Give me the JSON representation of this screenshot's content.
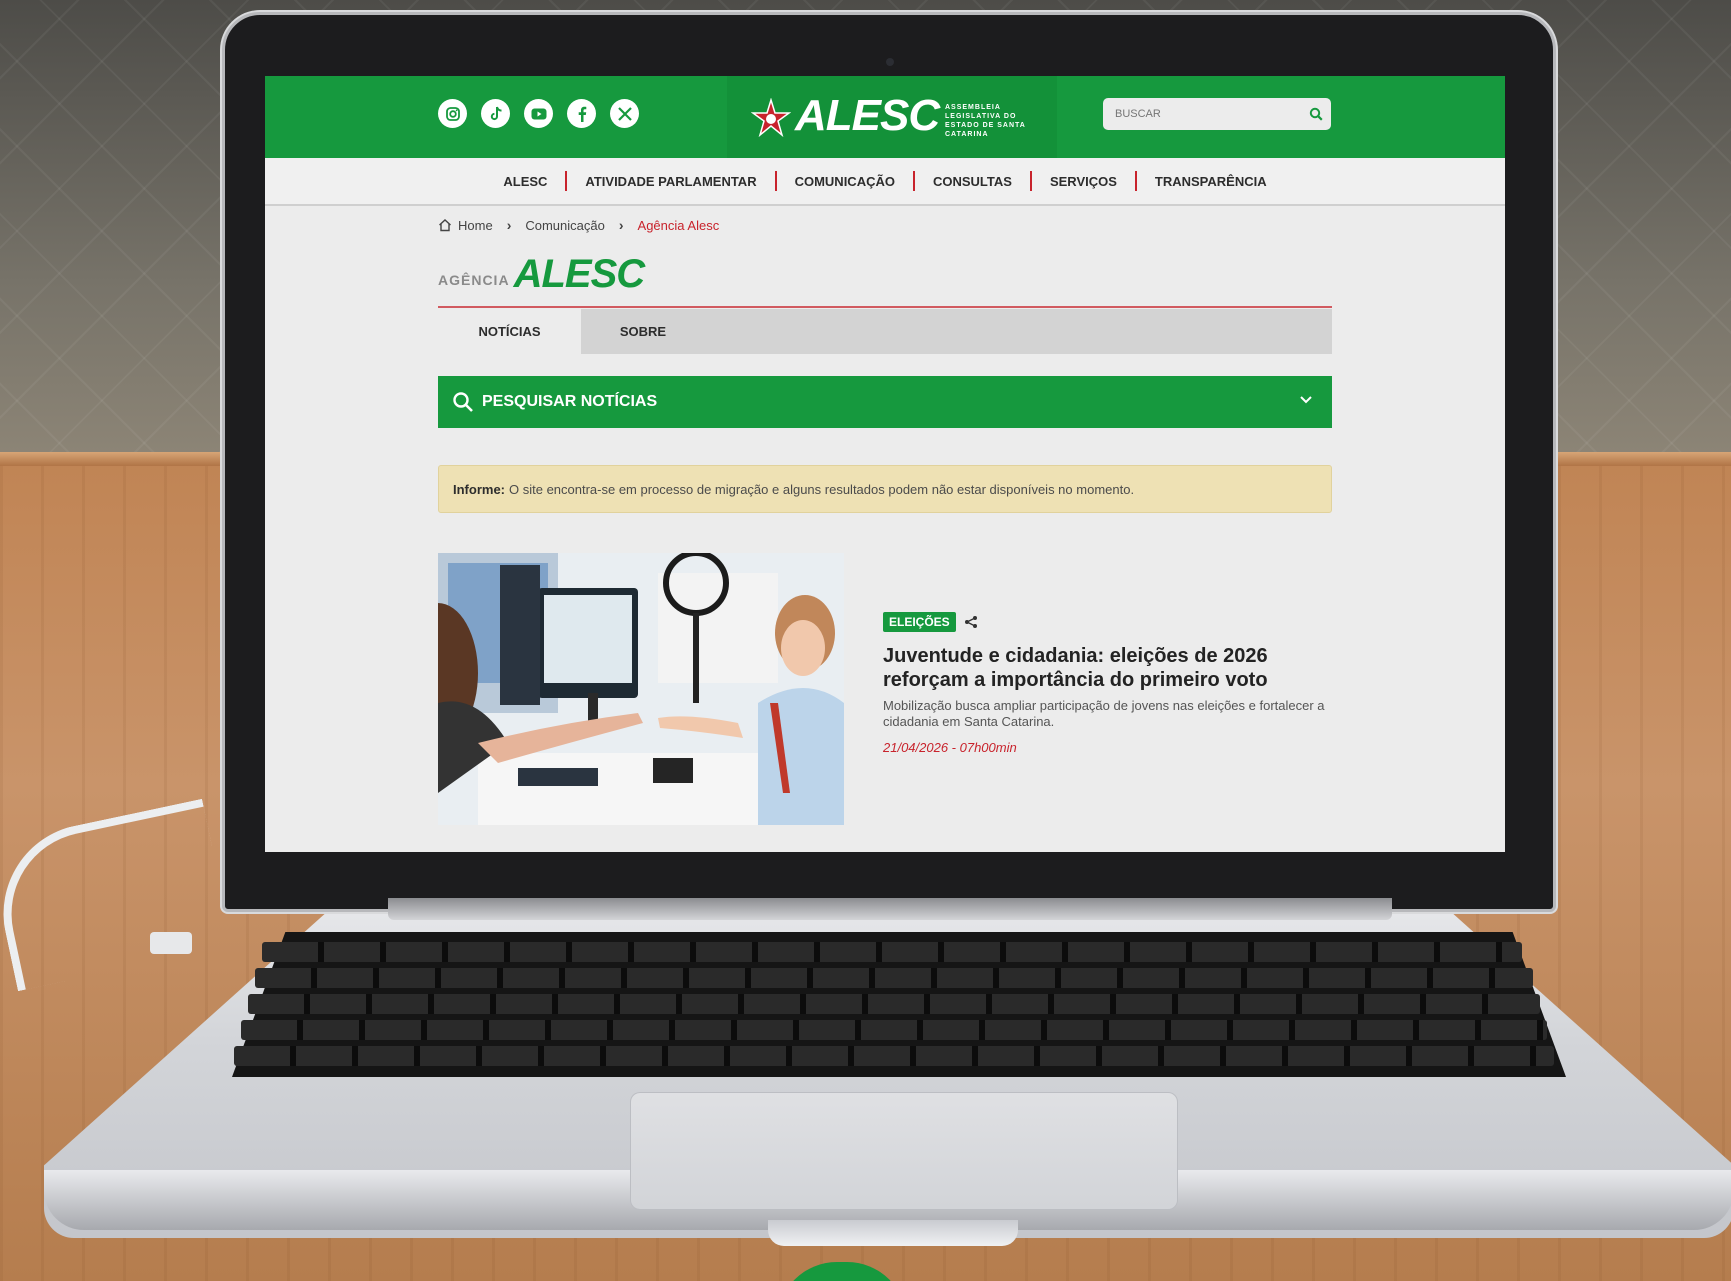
{
  "header": {
    "social_icons": [
      "instagram-icon",
      "tiktok-icon",
      "youtube-icon",
      "facebook-icon",
      "x-icon"
    ],
    "logo_text": "ALESC",
    "logo_subtitle": "ASSEMBLEIA LEGISLATIVA DO ESTADO DE SANTA CATARINA",
    "search_placeholder": "BUSCAR"
  },
  "nav": {
    "items": [
      "ALESC",
      "ATIVIDADE PARLAMENTAR",
      "COMUNICAÇÃO",
      "CONSULTAS",
      "SERVIÇOS",
      "TRANSPARÊNCIA"
    ]
  },
  "breadcrumb": {
    "items": [
      "Home",
      "Comunicação",
      "Agência Alesc"
    ]
  },
  "section": {
    "small": "AGÊNCIA",
    "big": "ALESC"
  },
  "tabs": [
    "NOTÍCIAS",
    "SOBRE"
  ],
  "search_news": {
    "label": "PESQUISAR NOTÍCIAS"
  },
  "notice": {
    "label": "Informe:",
    "text": "O site encontra-se em processo de migração e alguns resultados podem não estar disponíveis no momento."
  },
  "article": {
    "tag": "ELEIÇÕES",
    "headline": "Juventude e cidadania: eleições de 2026 reforçam a importância do primeiro voto",
    "summary": "Mobilização busca ampliar participação de jovens nas eleições e fortalecer a cidadania em Santa Catarina.",
    "date": "21/04/2026 - 07h00min"
  },
  "colors": {
    "brand_green": "#16993e",
    "accent_red": "#c8232c",
    "notice_bg": "#eee1b4"
  }
}
